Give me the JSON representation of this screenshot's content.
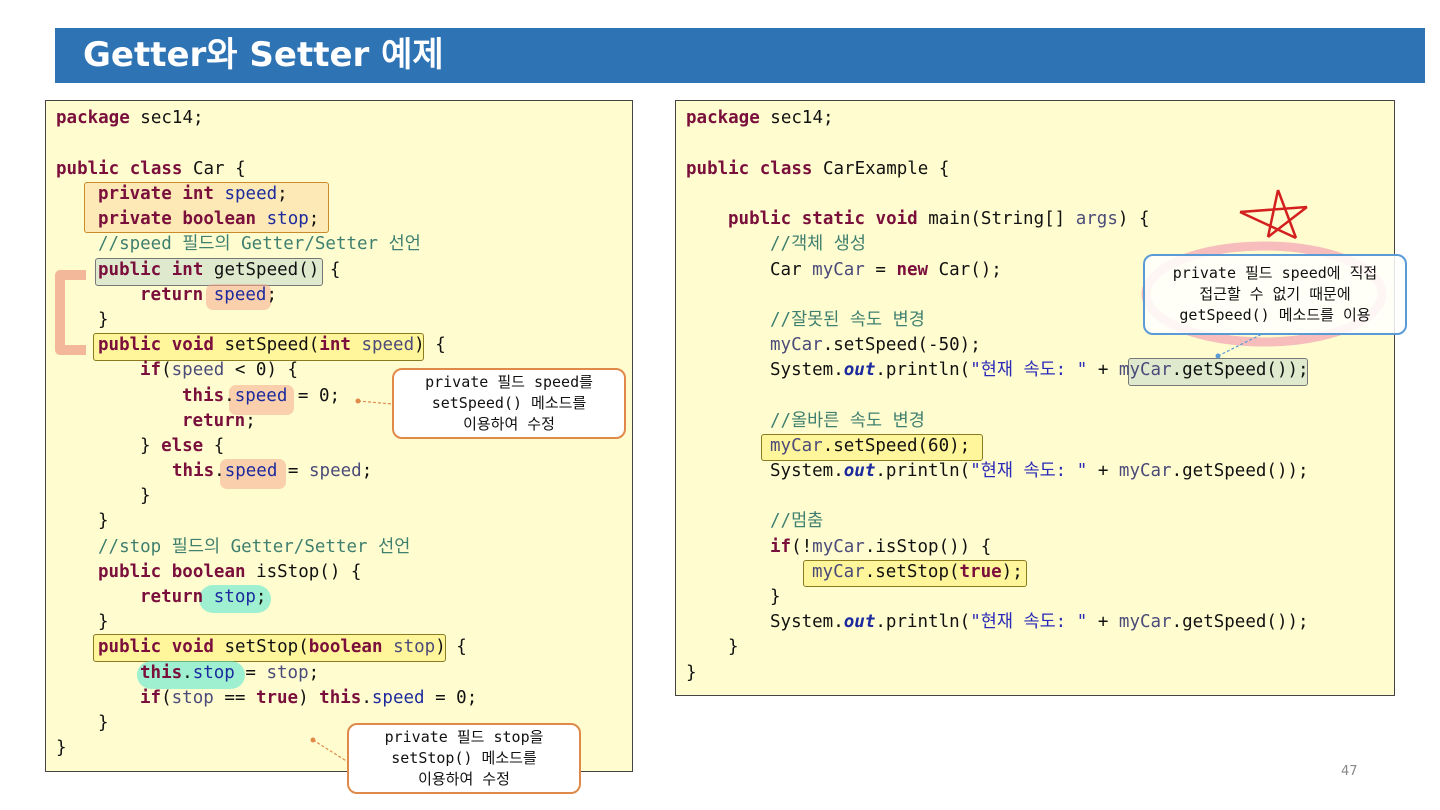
{
  "slide": {
    "title": "Getter와 Setter 예제",
    "page_number": "47"
  },
  "left_code": {
    "line1": {
      "a": "package",
      "b": " sec14;"
    },
    "line3": {
      "a": "public",
      "b": " ",
      "c": "class",
      "d": " Car {"
    },
    "line4": {
      "a": "private",
      "b": " ",
      "c": "int",
      "d": " ",
      "e": "speed",
      "f": ";"
    },
    "line5": {
      "a": "private",
      "b": " ",
      "c": "boolean",
      "d": " ",
      "e": "stop",
      "f": ";"
    },
    "line6": "//speed 필드의 Getter/Setter 선언",
    "line7": {
      "a": "public",
      "b": " ",
      "c": "int",
      "d": " getSpeed()",
      "e": " {"
    },
    "line8": {
      "a": "return",
      "b": " ",
      "c": "speed",
      "d": ";"
    },
    "line9": "}",
    "line10": {
      "a": "public",
      "b": " ",
      "c": "void",
      "d": " setSpeed(",
      "e": "int",
      "f": " ",
      "g": "speed",
      "h": ")",
      "i": " {"
    },
    "line11": {
      "a": "if",
      "b": "(",
      "c": "speed",
      "d": " < 0) {"
    },
    "line12": {
      "a": "this",
      "b": ".",
      "c": "speed",
      "d": " = 0;"
    },
    "line13": {
      "a": "return",
      "b": ";"
    },
    "line14": {
      "a": "} ",
      "b": "else",
      "c": " {"
    },
    "line15": {
      "a": "this",
      "b": ".",
      "c": "speed",
      "d": " = ",
      "e": "speed",
      "f": ";"
    },
    "line16": "}",
    "line17": "}",
    "line18": "//stop 필드의 Getter/Setter 선언",
    "line19": {
      "a": "public",
      "b": " ",
      "c": "boolean",
      "d": " isStop() {"
    },
    "line20": {
      "a": "return",
      "b": " ",
      "c": "stop",
      "d": ";"
    },
    "line21": "}",
    "line22": {
      "a": "public",
      "b": " ",
      "c": "void",
      "d": " setStop(",
      "e": "boolean",
      "f": " ",
      "g": "stop",
      "h": ")",
      "i": " {"
    },
    "line23": {
      "a": "this",
      "b": ".",
      "c": "stop",
      "d": " = ",
      "e": "stop",
      "f": ";"
    },
    "line24": {
      "a": "if",
      "b": "(",
      "c": "stop",
      "d": " == ",
      "e": "true",
      "f": ") ",
      "g": "this",
      "h": ".",
      "i": "speed",
      "j": " = 0;"
    },
    "line25": "}",
    "line26": "}"
  },
  "right_code": {
    "line1": {
      "a": "package",
      "b": " sec14;"
    },
    "line3": {
      "a": "public",
      "b": " ",
      "c": "class",
      "d": " CarExample {"
    },
    "line5": {
      "a": "public",
      "b": " ",
      "c": "static",
      "d": " ",
      "e": "void",
      "f": " main(String[] ",
      "g": "args",
      "h": ") {"
    },
    "line6": "//객체 생성",
    "line7": {
      "a": "Car ",
      "b": "myCar",
      "c": " = ",
      "d": "new",
      "e": " Car();"
    },
    "line9": "//잘못된 속도 변경",
    "line10": {
      "a": "myCar",
      "b": ".setSpeed(-50);"
    },
    "line11": {
      "a": "System.",
      "b": "out",
      "c": ".println(",
      "d": "\"현재 속도: \"",
      "e": " + ",
      "f": "myCar",
      "g": ".getSpeed()",
      "h": ");"
    },
    "line13": "//올바른 속도 변경",
    "line14": {
      "a": "myCar",
      "b": ".setSpeed(60);"
    },
    "line15": {
      "a": "System.",
      "b": "out",
      "c": ".println(",
      "d": "\"현재 속도: \"",
      "e": " + ",
      "f": "myCar",
      "g": ".getSpeed());"
    },
    "line17": "//멈춤",
    "line18": {
      "a": "if",
      "b": "(!",
      "c": "myCar",
      "d": ".isStop()) {"
    },
    "line19": {
      "a": "myCar",
      "b": ".setStop(",
      "c": "true",
      "d": ");"
    },
    "line20": "}",
    "line21": {
      "a": "System.",
      "b": "out",
      "c": ".println(",
      "d": "\"현재 속도: \"",
      "e": " + ",
      "f": "myCar",
      "g": ".getSpeed());"
    },
    "line22": "}",
    "line23": "}"
  },
  "callouts": {
    "set_speed": {
      "l1": "private 필드 speed를",
      "l2": "setSpeed() 메소드를",
      "l3": "이용하여 수정"
    },
    "set_stop": {
      "l1": "private 필드 stop을",
      "l2": "setStop() 메소드를",
      "l3": "이용하여 수정"
    },
    "get_speed": {
      "l1": "private 필드 speed에 직접",
      "l2": "접근할 수 없기 때문에",
      "l3": "getSpeed() 메소드를 이용"
    }
  },
  "colors": {
    "title_bar": "#2e74b5",
    "code_background": "#fffdd0",
    "keyword": "#7a0f3c",
    "field": "#1c2a9e",
    "comment": "#3f7f6f",
    "callout_orange_border": "#e08a4a",
    "callout_blue_border": "#5b9bd5"
  }
}
